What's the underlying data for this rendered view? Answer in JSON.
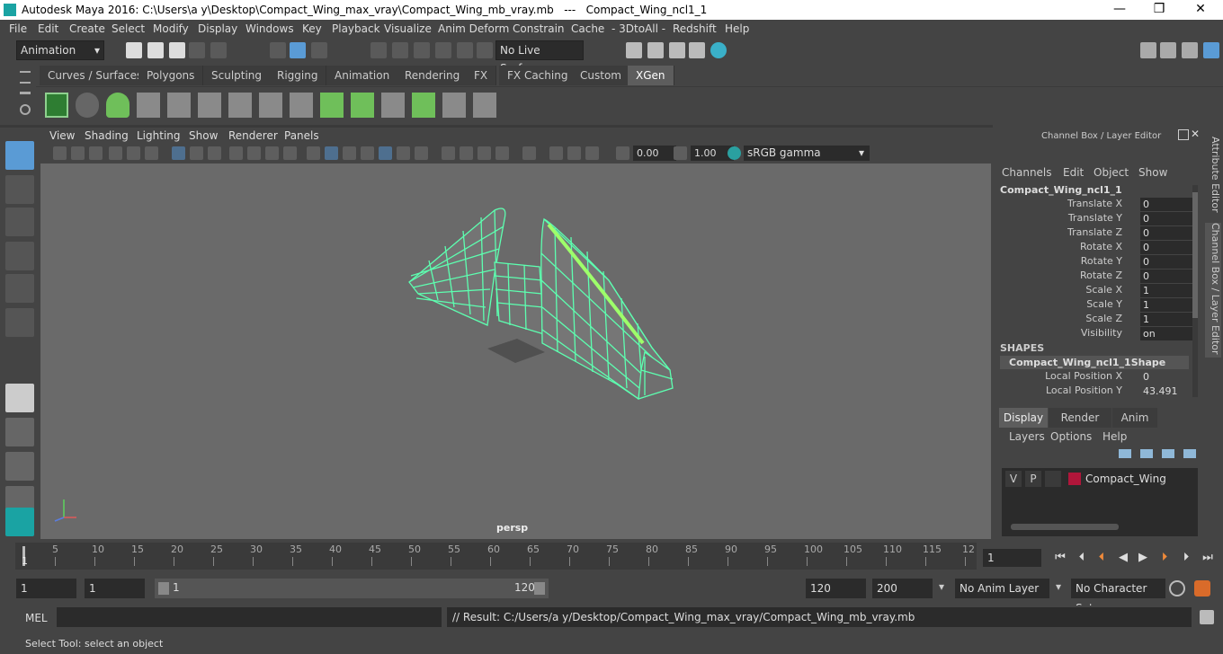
{
  "window": {
    "title": "Autodesk Maya 2016: C:\\Users\\a y\\Desktop\\Compact_Wing_max_vray\\Compact_Wing_mb_vray.mb   ---   Compact_Wing_ncl1_1",
    "minimize": "—",
    "maximize": "❒",
    "close": "✕"
  },
  "menubar": [
    "File",
    "Edit",
    "Create",
    "Select",
    "Modify",
    "Display",
    "Windows",
    "Key",
    "Playback",
    "Visualize",
    "Anim Deform",
    "Constrain",
    "Cache",
    "- 3DtoAll -",
    "Redshift",
    "Help"
  ],
  "statusline": {
    "mode": "Animation",
    "live_surface": "No Live Surface"
  },
  "shelf_tabs": [
    "Curves / Surfaces",
    "Polygons",
    "Sculpting",
    "Rigging",
    "Animation",
    "Rendering",
    "FX",
    "FX Caching",
    "Custom",
    "XGen"
  ],
  "shelf_active": "XGen",
  "viewport": {
    "menus": [
      "View",
      "Shading",
      "Lighting",
      "Show",
      "Renderer",
      "Panels"
    ],
    "exposure": "0.00",
    "gamma": "1.00",
    "colorspace": "sRGB gamma",
    "camera_label": "persp"
  },
  "channel_box": {
    "header": "Channel Box / Layer Editor",
    "menus": [
      "Channels",
      "Edit",
      "Object",
      "Show"
    ],
    "object_name": "Compact_Wing_ncl1_1",
    "channels": [
      {
        "label": "Translate X",
        "value": "0"
      },
      {
        "label": "Translate Y",
        "value": "0"
      },
      {
        "label": "Translate Z",
        "value": "0"
      },
      {
        "label": "Rotate X",
        "value": "0"
      },
      {
        "label": "Rotate Y",
        "value": "0"
      },
      {
        "label": "Rotate Z",
        "value": "0"
      },
      {
        "label": "Scale X",
        "value": "1"
      },
      {
        "label": "Scale Y",
        "value": "1"
      },
      {
        "label": "Scale Z",
        "value": "1"
      },
      {
        "label": "Visibility",
        "value": "on"
      }
    ],
    "shapes_header": "SHAPES",
    "shape_name": "Compact_Wing_ncl1_1Shape",
    "shape_channels": [
      {
        "label": "Local Position X",
        "value": "0"
      },
      {
        "label": "Local Position Y",
        "value": "43.491"
      }
    ]
  },
  "layer_editor": {
    "tabs": [
      "Display",
      "Render",
      "Anim"
    ],
    "active_tab": "Display",
    "menus": [
      "Layers",
      "Options",
      "Help"
    ],
    "layer": {
      "v": "V",
      "p": "P",
      "name": "Compact_Wing",
      "color": "#b0163a"
    }
  },
  "side_tabs": [
    "Attribute Editor",
    "Channel Box / Layer Editor"
  ],
  "timeline": {
    "ticks": [
      "5",
      "10",
      "15",
      "20",
      "25",
      "30",
      "35",
      "40",
      "45",
      "50",
      "55",
      "60",
      "65",
      "70",
      "75",
      "80",
      "85",
      "90",
      "95",
      "100",
      "105",
      "110",
      "115",
      "12"
    ],
    "start_marker": "1",
    "current_frame": "1"
  },
  "range": {
    "start": "1",
    "inner_start": "1",
    "slider_start": "1",
    "slider_end": "120",
    "end": "120",
    "outer_end": "200",
    "anim_layer": "No Anim Layer",
    "char_set": "No Character Set"
  },
  "mel": {
    "label": "MEL",
    "result": "// Result: C:/Users/a y/Desktop/Compact_Wing_max_vray/Compact_Wing_mb_vray.mb"
  },
  "helpline": "Select Tool: select an object",
  "colors": {
    "wire": "#5dffb0",
    "accent": "#5a9bd5"
  }
}
